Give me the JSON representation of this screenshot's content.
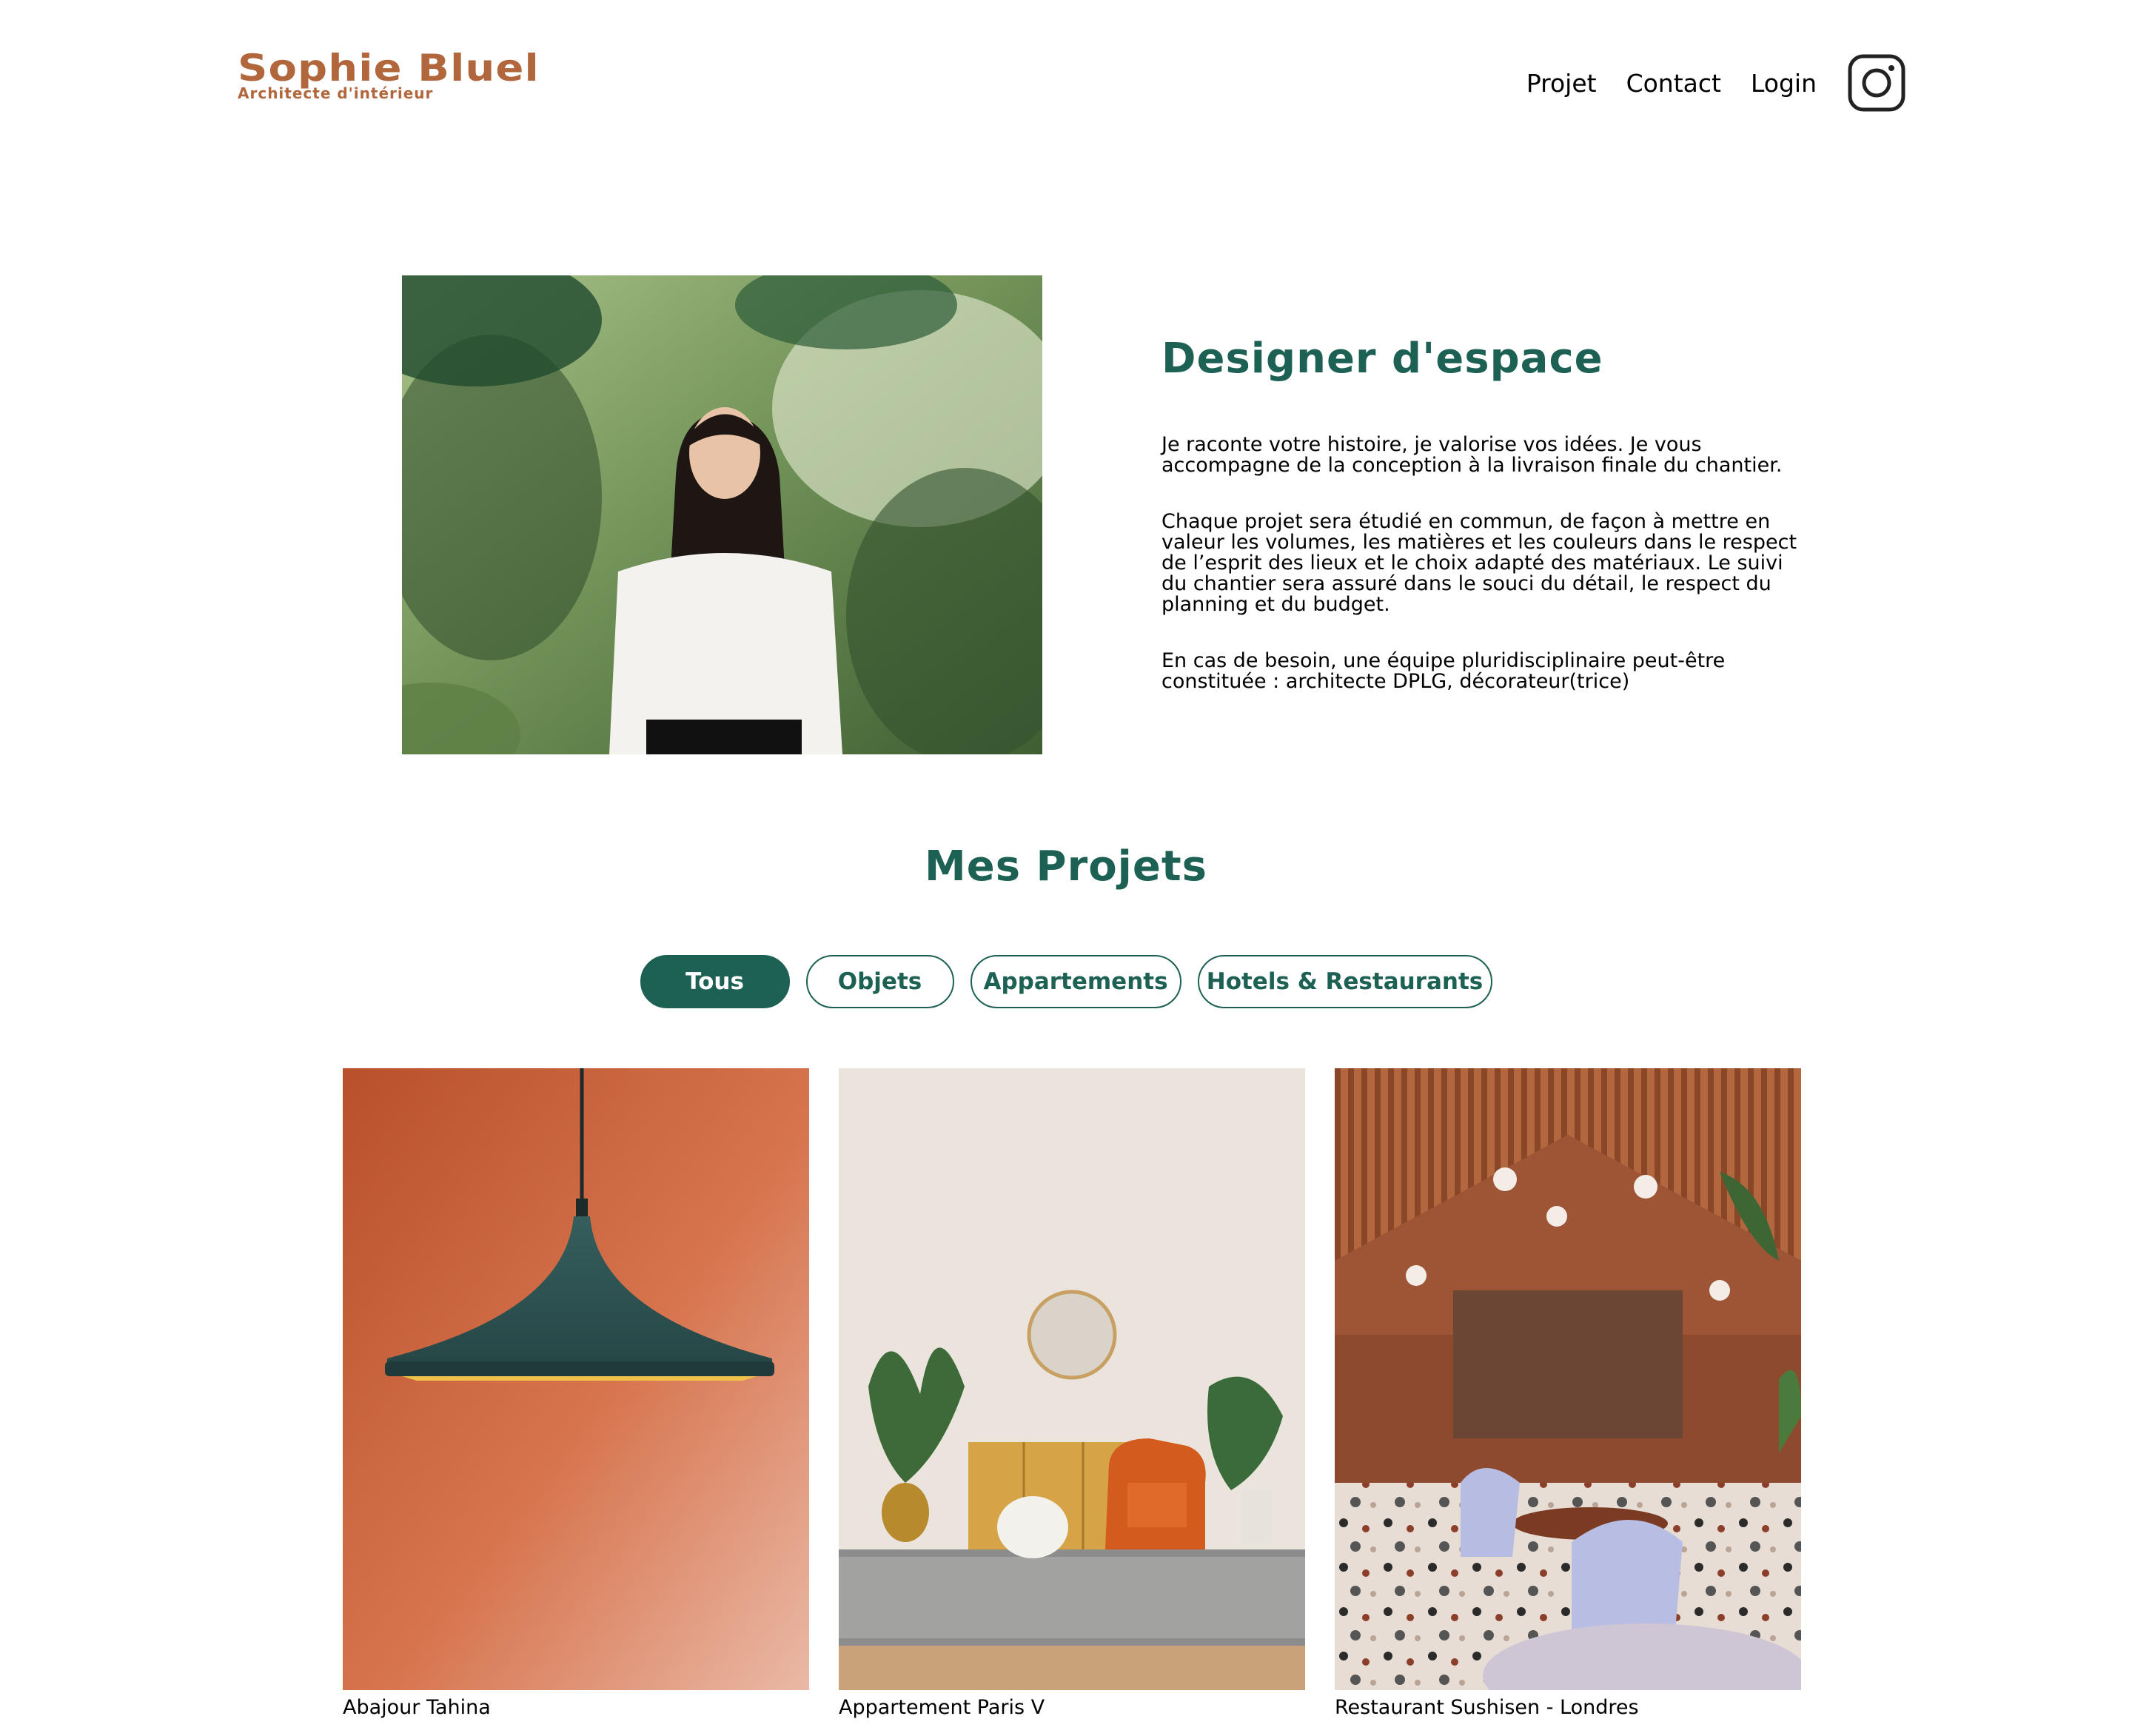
{
  "header": {
    "logo_name": "Sophie Bluel",
    "logo_subtitle": "Architecte d'intérieur",
    "nav": [
      "Projet",
      "Contact",
      "Login"
    ],
    "social_icon": "instagram-icon"
  },
  "intro": {
    "title": "Designer d'espace",
    "paragraphs": [
      "Je raconte votre histoire, je valorise vos idées. Je vous accompagne de la conception à la livraison finale du chantier.",
      "Chaque projet sera étudié en commun, de façon à mettre en valeur les volumes, les matières et les couleurs dans le respect de l’esprit des lieux et le choix adapté des matériaux. Le suivi du chantier sera assuré dans le souci du détail, le respect du planning et du budget.",
      "En cas de besoin, une équipe pluridisciplinaire peut-être constituée : architecte DPLG, décorateur(trice)"
    ]
  },
  "projects": {
    "title": "Mes Projets",
    "filters": [
      "Tous",
      "Objets",
      "Appartements",
      "Hotels & Restaurants"
    ],
    "active_filter": "Tous",
    "items": [
      "Abajour Tahina",
      "Appartement Paris V",
      "Restaurant Sushisen - Londres"
    ]
  },
  "colors": {
    "brand": "#B1663C",
    "accent": "#1D6154"
  }
}
